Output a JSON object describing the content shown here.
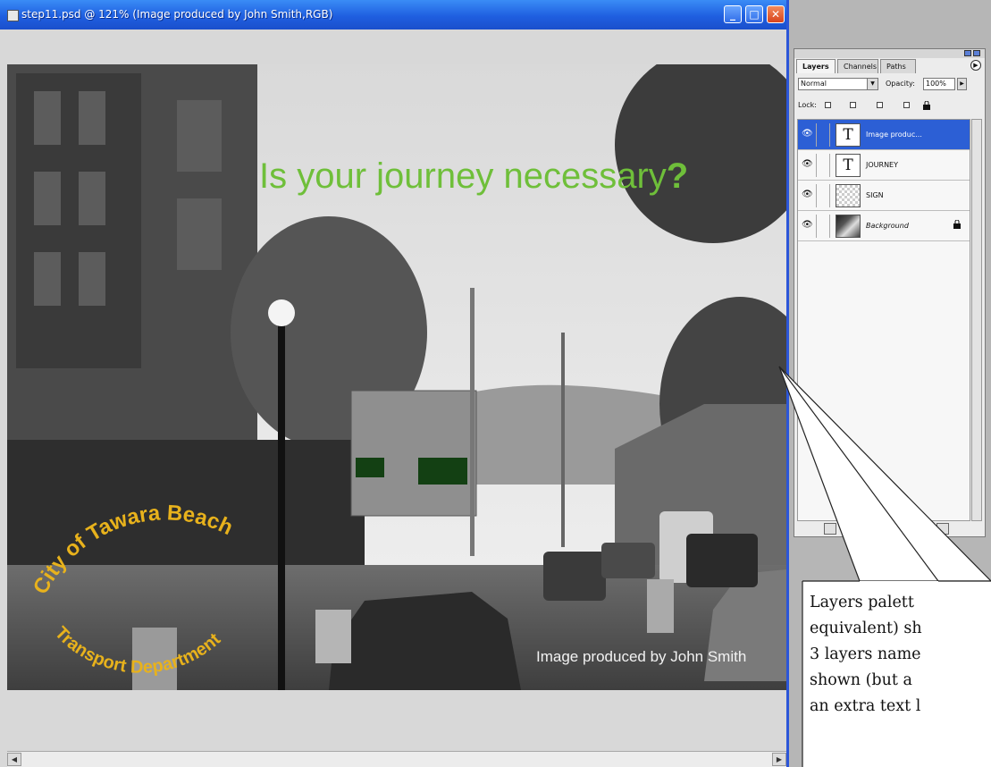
{
  "window": {
    "title": "step11.psd @ 121% (Image produced by John Smith,RGB)",
    "min_glyph": "_",
    "max_glyph": "□",
    "close_glyph": "✕"
  },
  "canvas": {
    "headline_main": "Is your journey necessary",
    "headline_mark": "?",
    "arc_text_top": "City of Tawara Beach",
    "arc_text_bottom": "Transport Department",
    "credit": "Image produced by John Smith",
    "colors": {
      "headline": "#6fbf3a",
      "arc_text": "#e8b21c"
    }
  },
  "layers_palette": {
    "tabs": [
      "Layers",
      "Channels",
      "Paths"
    ],
    "blend_mode": "Normal",
    "opacity_label": "Opacity:",
    "opacity_value": "100%",
    "lock_label": "Lock:",
    "layers": [
      {
        "name": "Image produc...",
        "thumb": "T",
        "selected": true,
        "lock": false
      },
      {
        "name": "JOURNEY",
        "thumb": "T",
        "selected": false,
        "lock": false
      },
      {
        "name": "SIGN",
        "thumb": "",
        "selected": false,
        "lock": false
      },
      {
        "name": "Background",
        "thumb": "",
        "selected": false,
        "lock": true
      }
    ],
    "selection_color": "#2c5fd5"
  },
  "callout": {
    "lines": [
      "Layers palett",
      "equivalent) sh",
      "3 layers name",
      "shown (but a",
      "an extra text l"
    ]
  }
}
